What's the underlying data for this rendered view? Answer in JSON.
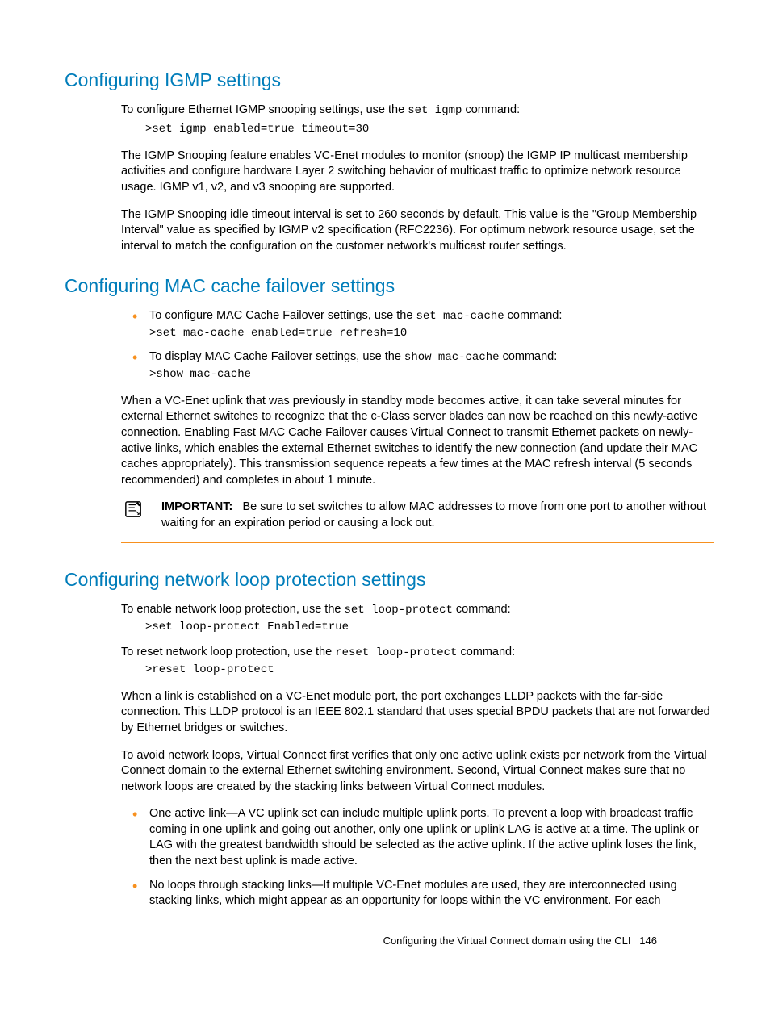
{
  "sections": {
    "igmp": {
      "heading": "Configuring IGMP settings",
      "intro": "To configure Ethernet IGMP snooping settings, use the ",
      "introCmd": "set igmp",
      "introTail": " command:",
      "cmd": ">set igmp enabled=true timeout=30",
      "p1": "The IGMP Snooping feature enables VC-Enet modules to monitor (snoop) the IGMP IP multicast membership activities and configure hardware Layer 2 switching behavior of multicast traffic to optimize network resource usage. IGMP v1, v2, and v3 snooping are supported.",
      "p2": "The IGMP Snooping idle timeout interval is set to 260 seconds by default. This value is the \"Group Membership Interval\" value as specified by IGMP v2 specification (RFC2236). For optimum network resource usage, set the interval to match the configuration on the customer network's multicast router settings."
    },
    "mac": {
      "heading": "Configuring MAC cache failover settings",
      "b1_text": "To configure MAC Cache Failover settings, use the ",
      "b1_cmd": "set mac-cache",
      "b1_tail": " command:",
      "b1_code": ">set mac-cache enabled=true refresh=10",
      "b2_text": "To display MAC Cache Failover settings, use the ",
      "b2_cmd": "show mac-cache",
      "b2_tail": " command:",
      "b2_code": ">show mac-cache",
      "p1": "When a VC-Enet uplink that was previously in standby mode becomes active, it can take several minutes for external Ethernet switches to recognize that the c-Class server blades can now be reached on this newly-active connection. Enabling Fast MAC Cache Failover causes Virtual Connect to transmit Ethernet packets on newly-active links, which enables the external Ethernet switches to identify the new connection (and update their MAC caches appropriately). This transmission sequence repeats a few times at the MAC refresh interval (5 seconds recommended) and completes in about 1 minute.",
      "importantLabel": "IMPORTANT:",
      "importantText": "Be sure to set switches to allow MAC addresses to move from one port to another without waiting for an expiration period or causing a lock out."
    },
    "loop": {
      "heading": "Configuring network loop protection settings",
      "intro1": "To enable network loop protection, use the ",
      "intro1Cmd": "set loop-protect",
      "intro1Tail": " command:",
      "cmd1": ">set loop-protect Enabled=true",
      "intro2": "To reset network loop protection, use the ",
      "intro2Cmd": "reset loop-protect",
      "intro2Tail": " command:",
      "cmd2": ">reset loop-protect",
      "p1": "When a link is established on a VC-Enet module port, the port exchanges LLDP packets with the far-side connection. This LLDP protocol is an IEEE 802.1 standard that uses special BPDU packets that are not forwarded by Ethernet bridges or switches.",
      "p2": "To avoid network loops, Virtual Connect first verifies that only one active uplink exists per network from the Virtual Connect domain to the external Ethernet switching environment. Second, Virtual Connect makes sure that no network loops are created by the stacking links between Virtual Connect modules.",
      "b1": "One active link—A VC uplink set can include multiple uplink ports. To prevent a loop with broadcast traffic coming in one uplink and going out another, only one uplink or uplink LAG is active at a time. The uplink or LAG with the greatest bandwidth should be selected as the active uplink. If the active uplink loses the link, then the next best uplink is made active.",
      "b2": "No loops through stacking links—If multiple VC-Enet modules are used, they are interconnected using stacking links, which might appear as an opportunity for loops within the VC environment. For each"
    }
  },
  "footer": {
    "text": "Configuring the Virtual Connect domain using the CLI",
    "page": "146"
  }
}
